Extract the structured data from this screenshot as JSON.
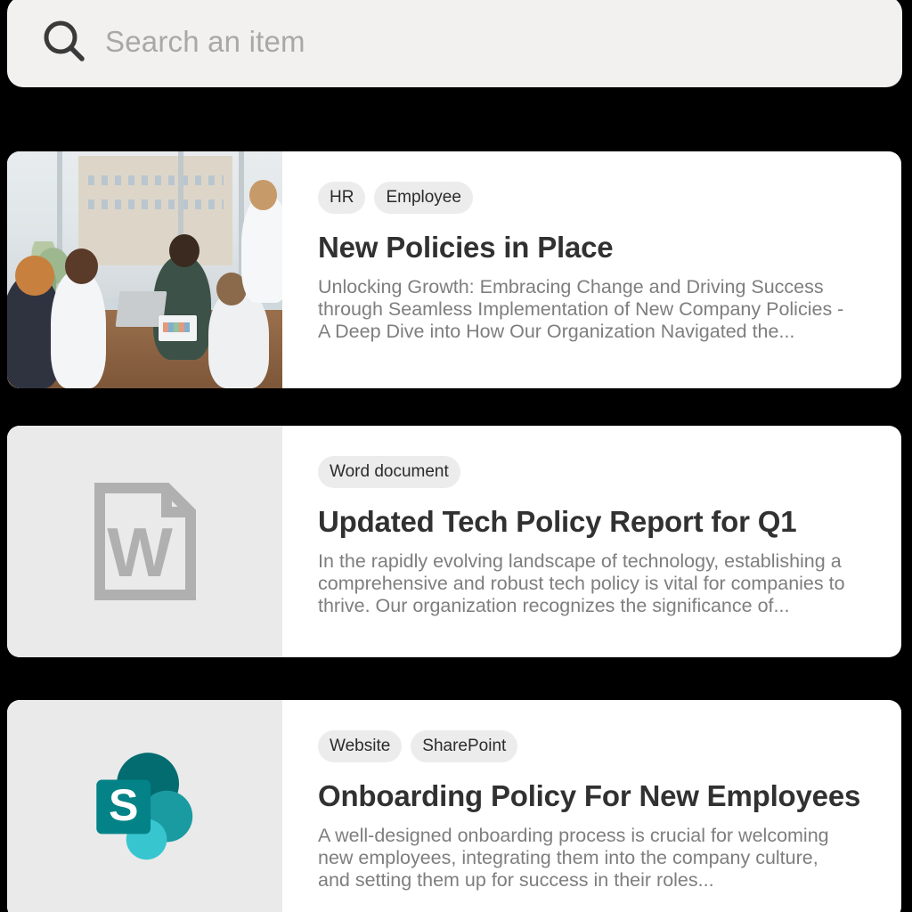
{
  "search": {
    "placeholder": "Search an item",
    "value": "",
    "icon": "search-icon"
  },
  "results": [
    {
      "tags": [
        "HR",
        "Employee"
      ],
      "title": "New Policies in Place",
      "description": "Unlocking Growth: Embracing Change and Driving Success through Seamless Implementation of New Company Policies - A Deep Dive into How Our Organization Navigated the...",
      "thumbnail_type": "photo",
      "thumbnail_alt": "office-meeting-photo"
    },
    {
      "tags": [
        "Word document"
      ],
      "title": "Updated Tech Policy Report for Q1",
      "description": "In the rapidly evolving landscape of technology, establishing a comprehensive and robust tech policy is vital for companies to thrive. Our organization recognizes the significance of...",
      "thumbnail_type": "word-document-icon",
      "thumbnail_alt": "word-document-icon"
    },
    {
      "tags": [
        "Website",
        "SharePoint"
      ],
      "title": "Onboarding Policy For New Employees",
      "description": "A well-designed onboarding process is crucial for welcoming new employees, integrating them into the company culture, and setting them up for success in their roles...",
      "thumbnail_type": "sharepoint-logo",
      "thumbnail_alt": "sharepoint-logo"
    }
  ],
  "colors": {
    "search_background": "#f2f1f0",
    "placeholder_text": "#a8a8a8",
    "card_background": "#ffffff",
    "thumbnail_panel": "#eaeaea",
    "tag_background": "#ececec",
    "tag_text": "#2b2b2b",
    "title_text": "#313131",
    "description_text": "#7e7e7e",
    "word_icon_gray": "#b0b0b0",
    "sharepoint_dark_teal": "#036c70",
    "sharepoint_mid_teal": "#1a9ba1",
    "sharepoint_light_teal": "#37c6d0",
    "sharepoint_square": "#038387",
    "page_background": "#000000"
  }
}
